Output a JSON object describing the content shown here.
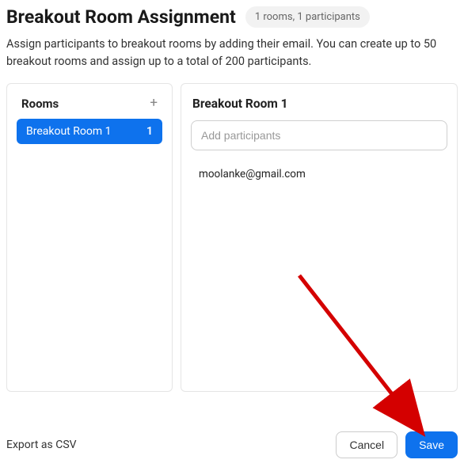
{
  "header": {
    "title": "Breakout Room Assignment",
    "badge": "1 rooms, 1 participants"
  },
  "description": "Assign participants to breakout rooms by adding their email. You can create up to 50 breakout rooms and assign up to a total of 200 participants.",
  "sidebar": {
    "label": "Rooms",
    "items": [
      {
        "name": "Breakout Room 1",
        "count": "1"
      }
    ]
  },
  "main": {
    "room_title": "Breakout Room 1",
    "add_placeholder": "Add participants",
    "participants": [
      "moolanke@gmail.com"
    ]
  },
  "footer": {
    "export": "Export as CSV",
    "cancel": "Cancel",
    "save": "Save"
  },
  "colors": {
    "primary": "#0e72ed",
    "badge_bg": "#f2f2f2",
    "arrow": "#d40000"
  }
}
